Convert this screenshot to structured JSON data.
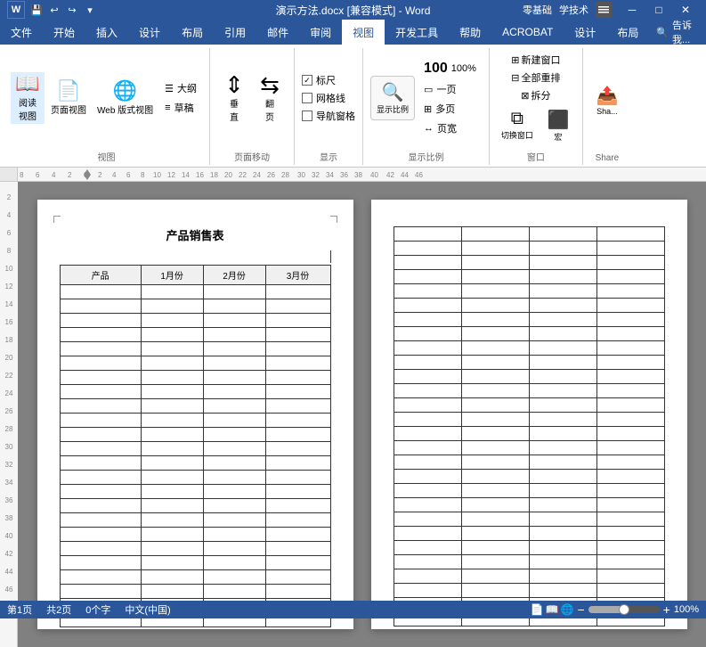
{
  "title_bar": {
    "doc_name": "演示方法.docx [兼容模式] - Word",
    "right_links": [
      "零基础",
      "学技术"
    ],
    "minimize": "─",
    "maximize": "□",
    "close": "✕"
  },
  "quick_access": {
    "save": "💾",
    "undo": "↩",
    "redo": "↪",
    "more": "▾"
  },
  "ribbon": {
    "active_tab": "视图",
    "tabs": [
      "文件",
      "开始",
      "插入",
      "设计",
      "布局",
      "引用",
      "邮件",
      "审阅",
      "视图",
      "开发工具",
      "帮助",
      "ACROBAT",
      "设计",
      "布局"
    ],
    "tell_me": "告诉我...",
    "groups": {
      "views": {
        "label": "视图",
        "buttons": [
          {
            "id": "read",
            "icon": "📖",
            "label": "阅读\n视图"
          },
          {
            "id": "page",
            "icon": "📄",
            "label": "页面视图"
          },
          {
            "id": "web",
            "icon": "🌐",
            "label": "Web 版式视图"
          }
        ],
        "small_buttons": [
          {
            "icon": "☰",
            "label": "大纲"
          },
          {
            "icon": "≡",
            "label": "草稿"
          }
        ]
      },
      "page_move": {
        "label": "页面移动",
        "buttons": [
          {
            "id": "vertical",
            "icon": "⇅",
            "label": "垂\n直"
          },
          {
            "id": "side",
            "icon": "⇆",
            "label": "翻\n页"
          }
        ]
      },
      "show": {
        "label": "显示",
        "checkboxes": [
          {
            "label": "标尺",
            "checked": true
          },
          {
            "label": "网格线",
            "checked": false
          },
          {
            "label": "导航窗格",
            "checked": false
          }
        ]
      },
      "zoom": {
        "label": "显示比例",
        "zoom_btn_label": "显示比例",
        "zoom_value": "100%",
        "one_page": "一",
        "multi_page": "⊞",
        "page_width": "↔"
      },
      "window": {
        "label": "窗口",
        "buttons": [
          {
            "icon": "⊞",
            "label": "新建窗口"
          },
          {
            "icon": "⊟",
            "label": "全部重排"
          },
          {
            "icon": "⊠",
            "label": "拆分"
          }
        ],
        "switch_btn": {
          "icon": "⧉",
          "label": "切换窗口"
        },
        "macro_btn": {
          "icon": "⬛",
          "label": "宏"
        }
      }
    }
  },
  "ruler": {
    "marks": [
      "-8",
      "-6",
      "-4",
      "-2",
      "0",
      "2",
      "4",
      "6",
      "8",
      "10",
      "12",
      "14",
      "16",
      "18",
      "20",
      "22",
      "24",
      "26",
      "28",
      "30",
      "32",
      "34",
      "36",
      "38",
      "40",
      "42",
      "44",
      "46"
    ]
  },
  "page1": {
    "title": "产品销售表",
    "headers": [
      "产品",
      "1月份",
      "2月份",
      "3月份"
    ],
    "rows": 24
  },
  "page2": {
    "cols": 4,
    "rows": 28
  },
  "status_bar": {
    "page": "第1页",
    "total": "共2页",
    "words": "0个字",
    "lang": "中文(中国)"
  }
}
